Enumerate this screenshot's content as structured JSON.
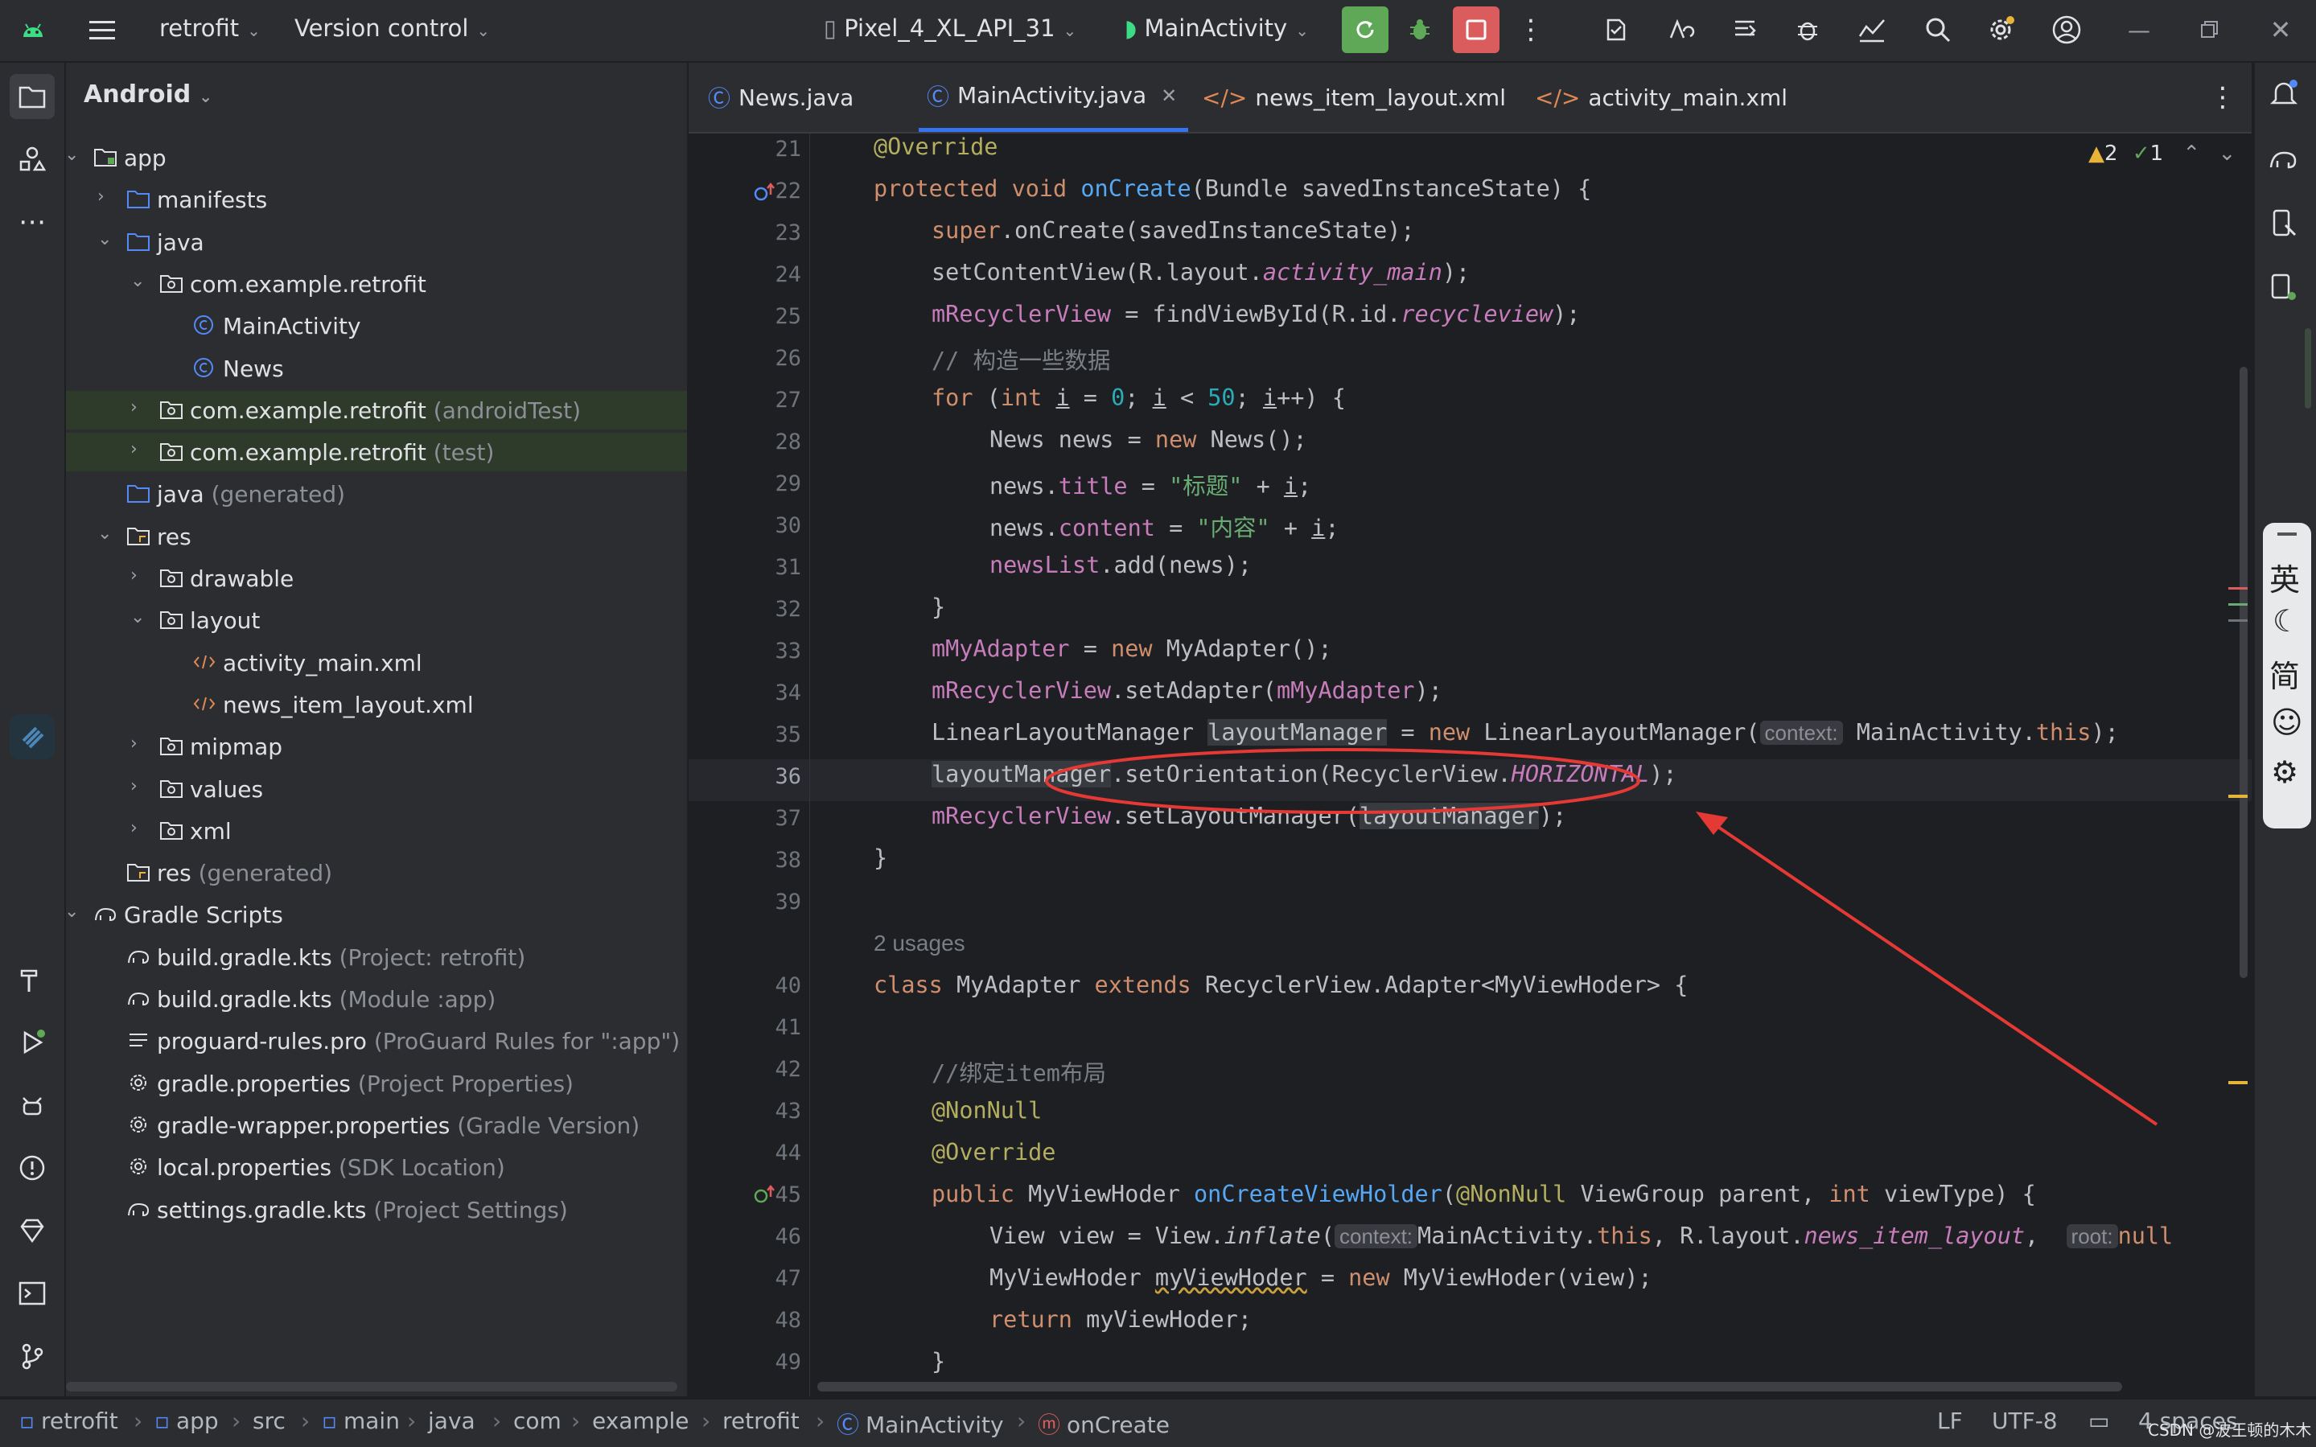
{
  "titlebar": {
    "project_name": "retrofit",
    "vcs_label": "Version control",
    "device": "Pixel_4_XL_API_31",
    "run_config": "MainActivity",
    "colors": {
      "run_green": "#5fa857",
      "stop_red": "#db5c5c"
    }
  },
  "project_panel": {
    "view_label": "Android",
    "tree": [
      {
        "label": "app",
        "suffix": "",
        "icon": "module-folder-icon"
      },
      {
        "label": "manifests",
        "suffix": "",
        "icon": "folder-icon"
      },
      {
        "label": "java",
        "suffix": "",
        "icon": "folder-icon"
      },
      {
        "label": "com.example.retrofit",
        "suffix": "",
        "icon": "package-icon"
      },
      {
        "label": "MainActivity",
        "suffix": "",
        "icon": "class-icon"
      },
      {
        "label": "News",
        "suffix": "",
        "icon": "class-icon"
      },
      {
        "label": "com.example.retrofit",
        "suffix": "(androidTest)",
        "icon": "package-icon"
      },
      {
        "label": "com.example.retrofit",
        "suffix": "(test)",
        "icon": "package-icon"
      },
      {
        "label": "java",
        "suffix": "(generated)",
        "icon": "folder-icon"
      },
      {
        "label": "res",
        "suffix": "",
        "icon": "res-folder-icon"
      },
      {
        "label": "drawable",
        "suffix": "",
        "icon": "package-icon"
      },
      {
        "label": "layout",
        "suffix": "",
        "icon": "package-icon"
      },
      {
        "label": "activity_main.xml",
        "suffix": "",
        "icon": "xml-icon"
      },
      {
        "label": "news_item_layout.xml",
        "suffix": "",
        "icon": "xml-icon"
      },
      {
        "label": "mipmap",
        "suffix": "",
        "icon": "package-icon"
      },
      {
        "label": "values",
        "suffix": "",
        "icon": "package-icon"
      },
      {
        "label": "xml",
        "suffix": "",
        "icon": "package-icon"
      },
      {
        "label": "res",
        "suffix": "(generated)",
        "icon": "res-folder-icon"
      },
      {
        "label": "Gradle Scripts",
        "suffix": "",
        "icon": "gradle-icon"
      },
      {
        "label": "build.gradle.kts",
        "suffix": "(Project: retrofit)",
        "icon": "gradle-icon"
      },
      {
        "label": "build.gradle.kts",
        "suffix": "(Module :app)",
        "icon": "gradle-icon"
      },
      {
        "label": "proguard-rules.pro",
        "suffix": "(ProGuard Rules for \":app\")",
        "icon": "text-file-icon"
      },
      {
        "label": "gradle.properties",
        "suffix": "(Project Properties)",
        "icon": "settings-file-icon"
      },
      {
        "label": "gradle-wrapper.properties",
        "suffix": "(Gradle Version)",
        "icon": "settings-file-icon"
      },
      {
        "label": "local.properties",
        "suffix": "(SDK Location)",
        "icon": "settings-file-icon"
      },
      {
        "label": "settings.gradle.kts",
        "suffix": "(Project Settings)",
        "icon": "gradle-icon"
      }
    ]
  },
  "editor": {
    "tabs": [
      {
        "label": "News.java",
        "active": false
      },
      {
        "label": "MainActivity.java",
        "active": true
      },
      {
        "label": "news_item_layout.xml",
        "active": false
      },
      {
        "label": "activity_main.xml",
        "active": false
      }
    ],
    "inspections": {
      "warnings": "2",
      "checks": "1"
    },
    "line_numbers": [
      "21",
      "22",
      "23",
      "24",
      "25",
      "26",
      "27",
      "28",
      "29",
      "30",
      "31",
      "32",
      "33",
      "34",
      "35",
      "36",
      "37",
      "38",
      "39",
      "40",
      "41",
      "42",
      "43",
      "44",
      "45",
      "46",
      "47",
      "48",
      "49"
    ],
    "usages_text": "2 usages",
    "hints": {
      "context": "context:",
      "root": "root:"
    },
    "code": {
      "l21": "@Override",
      "l22a": "protected void ",
      "l22b": "onCreate",
      "l22c": "(Bundle savedInstanceState) {",
      "l23a": "super",
      "l23b": ".onCreate(savedInstanceState);",
      "l24a": "setContentView(R.layout.",
      "l24b": "activity_main",
      "l24c": ");",
      "l25a": "mRecyclerView",
      "l25b": " = findViewById(R.id.",
      "l25c": "recycleview",
      "l25d": ");",
      "l26": "// 构造一些数据",
      "l27a": "for",
      "l27b": " (",
      "l27c": "int ",
      "l27d": "i",
      "l27e": " = ",
      "l27f": "0",
      "l27g": "; ",
      "l27h": "i",
      "l27i": " < ",
      "l27j": "50",
      "l27k": "; ",
      "l27l": "i",
      "l27m": "++) {",
      "l28a": "News news = ",
      "l28b": "new ",
      "l28c": "News();",
      "l29a": "news.",
      "l29b": "title",
      "l29c": " = ",
      "l29d": "\"标题\"",
      "l29e": " + ",
      "l29f": "i",
      "l29g": ";",
      "l30a": "news.",
      "l30b": "content",
      "l30c": " = ",
      "l30d": "\"内容\"",
      "l30e": " + ",
      "l30f": "i",
      "l30g": ";",
      "l31a": "newsList",
      "l31b": ".add(news);",
      "l32": "}",
      "l33a": "mMyAdapter",
      "l33b": " = ",
      "l33c": "new ",
      "l33d": "MyAdapter();",
      "l34a": "mRecyclerView",
      "l34b": ".setAdapter(",
      "l34c": "mMyAdapter",
      "l34d": ");",
      "l35a": "LinearLayoutManager ",
      "l35b": "layoutManager",
      "l35c": " = ",
      "l35d": "new ",
      "l35e": "LinearLayoutManager(",
      "l35f": "MainActivity.",
      "l35g": "this",
      "l35h": ");",
      "l36a": "layoutManager",
      "l36b": ".setOrientation(RecyclerView.",
      "l36c": "HORIZONTAL",
      "l36d": ");",
      "l37a": "mRecyclerView",
      "l37b": ".setLayoutManager(",
      "l37c": "layoutManager",
      "l37d": ");",
      "l38": "}",
      "l40a": "class ",
      "l40b": "MyAdapter ",
      "l40c": "extends ",
      "l40d": "RecyclerView.Adapter<MyViewHoder> {",
      "l42": "//绑定item布局",
      "l43": "@NonNull",
      "l44": "@Override",
      "l45a": "public ",
      "l45b": "MyViewHoder ",
      "l45c": "onCreateViewHolder",
      "l45d": "(",
      "l45e": "@NonNull ",
      "l45f": "ViewGroup parent, ",
      "l45g": "int ",
      "l45h": "viewType) {",
      "l46a": "View view = View.",
      "l46b": "inflate",
      "l46c": "(",
      "l46d": "MainActivity.",
      "l46e": "this",
      "l46f": ", R.layout.",
      "l46g": "news_item_layout",
      "l46h": ", ",
      "l46i": "null",
      "l47a": "MyViewHoder ",
      "l47b": "myViewHoder",
      "l47c": " = ",
      "l47d": "new ",
      "l47e": "MyViewHoder(view);",
      "l48a": "return ",
      "l48b": "myViewHoder;",
      "l49": "}"
    }
  },
  "ime_toolbar": {
    "chars": [
      "英",
      "简"
    ]
  },
  "statusbar": {
    "breadcrumb": [
      "retrofit",
      "app",
      "src",
      "main",
      "java",
      "com",
      "example",
      "retrofit",
      "MainActivity",
      "onCreate"
    ],
    "line_ending": "LF",
    "encoding": "UTF-8",
    "indent": "4 spaces",
    "watermark": "CSDN @波王顿的木木"
  }
}
